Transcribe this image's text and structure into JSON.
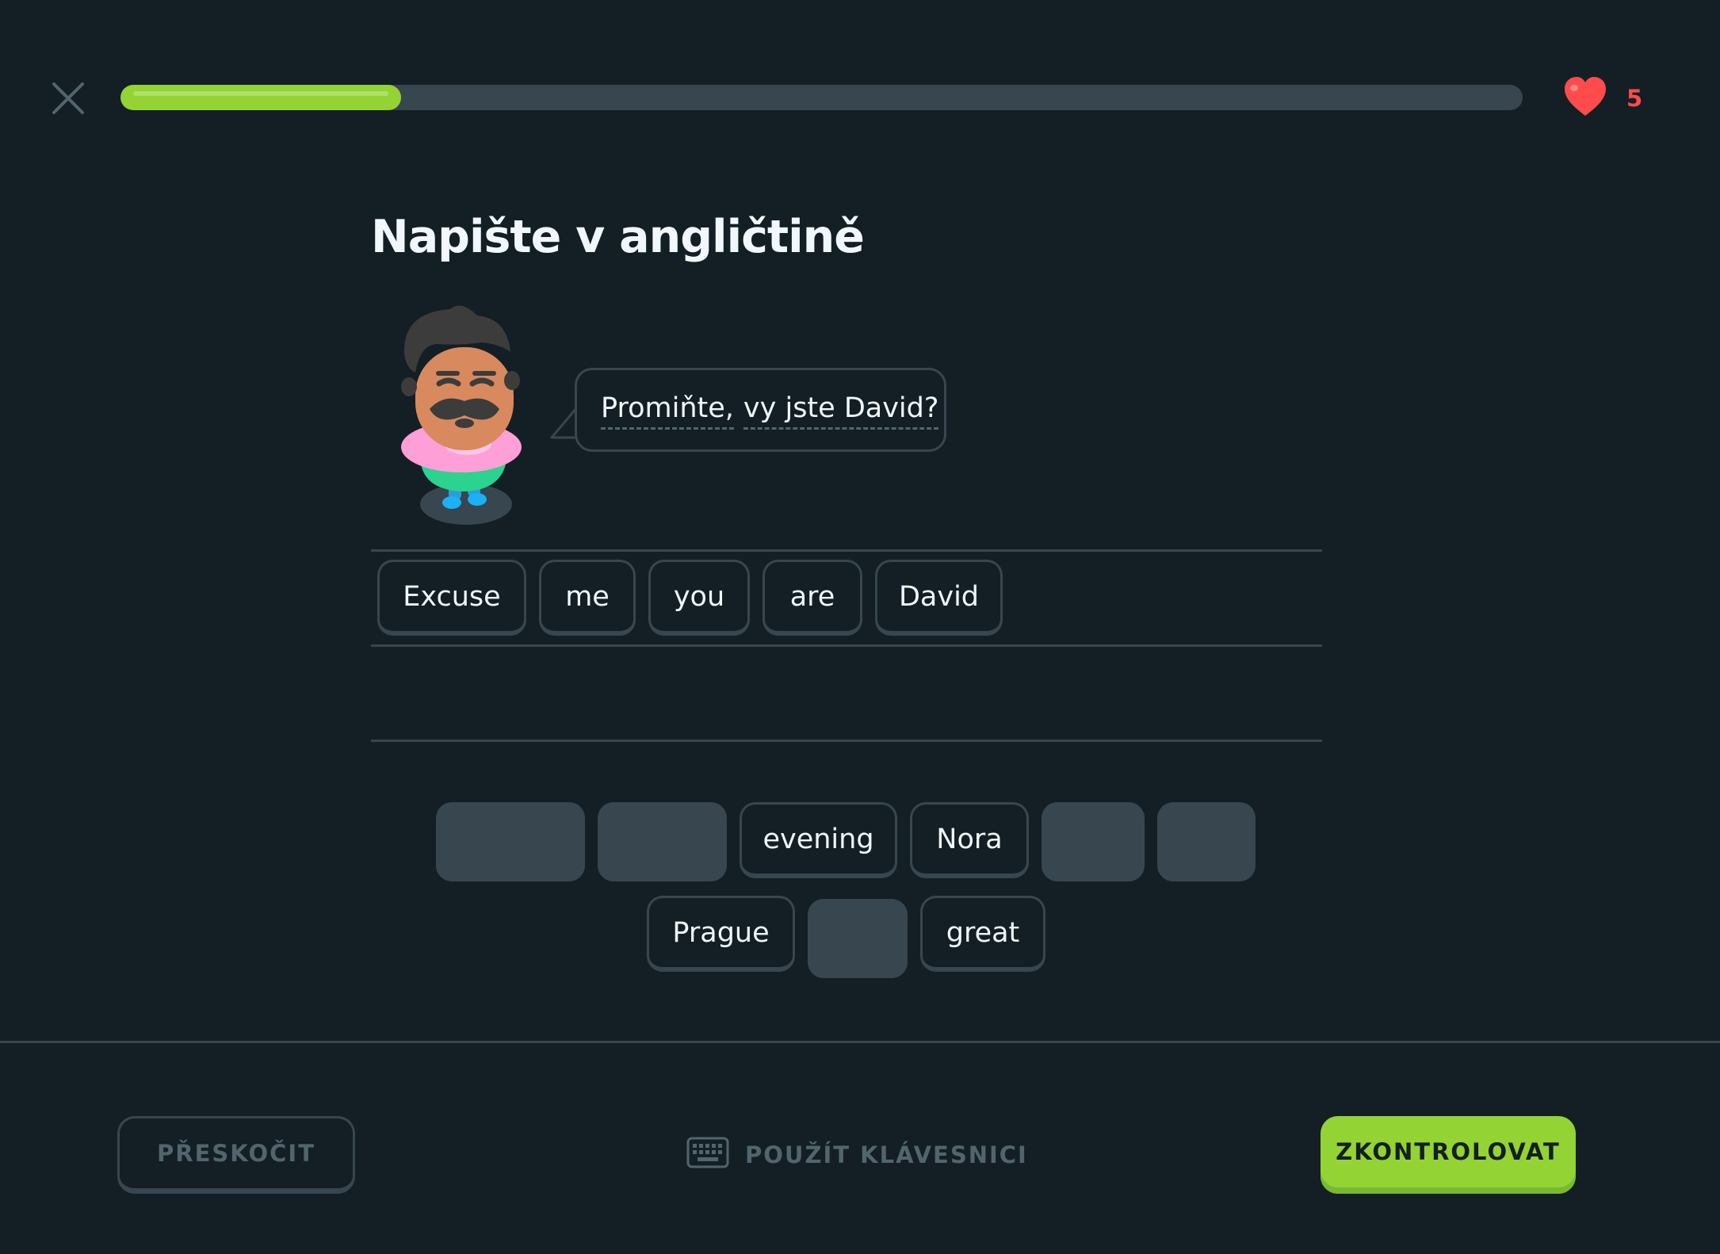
{
  "header": {
    "close_icon": "close-x-icon",
    "progress_fraction": 0.2,
    "hearts": {
      "icon": "heart-icon",
      "count": "5"
    }
  },
  "exercise": {
    "title": "Napište v angličtině",
    "character": "character-illustration",
    "prompt_words": [
      "Promiňte,",
      "vy jste David?"
    ]
  },
  "answer": {
    "selected_words": [
      "Excuse",
      "me",
      "you",
      "are",
      "David"
    ]
  },
  "word_bank": {
    "row1": [
      {
        "type": "slot"
      },
      {
        "type": "slot"
      },
      {
        "type": "word",
        "label": "evening"
      },
      {
        "type": "word",
        "label": "Nora"
      },
      {
        "type": "slot"
      },
      {
        "type": "slot"
      }
    ],
    "row2": [
      {
        "type": "word",
        "label": "Prague"
      },
      {
        "type": "slot"
      },
      {
        "type": "word",
        "label": "great"
      }
    ]
  },
  "footer": {
    "skip_label": "PŘESKOČIT",
    "keyboard_icon": "keyboard-icon",
    "keyboard_label": "POUŽÍT KLÁVESNICI",
    "check_label": "ZKONTROLOVAT"
  },
  "colors": {
    "background": "#131f24",
    "accent_green": "#93d333",
    "heart_red": "#ff4b4b",
    "border": "#37464f",
    "muted_text": "#52656d"
  }
}
